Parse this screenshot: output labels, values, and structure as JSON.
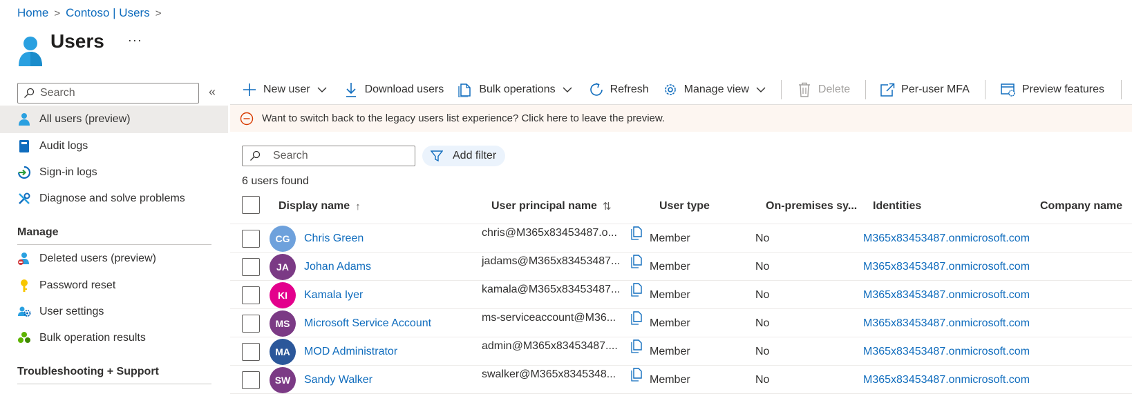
{
  "breadcrumb": [
    "Home",
    "Contoso | Users"
  ],
  "page": {
    "title": "Users",
    "more": "···"
  },
  "sidebar": {
    "search_placeholder": "Search",
    "collapse": "«",
    "items": [
      {
        "label": "All users (preview)",
        "icon": "user-icon"
      },
      {
        "label": "Audit logs",
        "icon": "book-icon"
      },
      {
        "label": "Sign-in logs",
        "icon": "sign-in-icon"
      },
      {
        "label": "Diagnose and solve problems",
        "icon": "wrench-icon"
      }
    ],
    "manage_header": "Manage",
    "manage_items": [
      {
        "label": "Deleted users (preview)",
        "icon": "deleted-user-icon"
      },
      {
        "label": "Password reset",
        "icon": "key-icon"
      },
      {
        "label": "User settings",
        "icon": "user-settings-icon"
      },
      {
        "label": "Bulk operation results",
        "icon": "bulk-results-icon"
      }
    ],
    "troubleshooting_header": "Troubleshooting + Support"
  },
  "toolbar": {
    "new_user": "New user",
    "download_users": "Download users",
    "bulk_operations": "Bulk operations",
    "refresh": "Refresh",
    "manage_view": "Manage view",
    "delete": "Delete",
    "per_user_mfa": "Per-user MFA",
    "preview_features": "Preview features"
  },
  "banner": {
    "text": "Want to switch back to the legacy users list experience? Click here to leave the preview."
  },
  "list": {
    "search_placeholder": "Search",
    "add_filter": "Add filter",
    "count": "6 users found"
  },
  "table": {
    "columns": {
      "display_name": "Display name",
      "display_name_sort": "↑",
      "upn": "User principal name",
      "upn_sort": "⇅",
      "user_type": "User type",
      "onprem": "On-premises sy...",
      "identities": "Identities",
      "company": "Company name"
    },
    "rows": [
      {
        "initials": "CG",
        "color": "#6ea1dc",
        "name": "Chris Green",
        "upn": "chris@M365x83453487.o...",
        "type": "Member",
        "onprem": "No",
        "identity": "M365x83453487.onmicrosoft.com"
      },
      {
        "initials": "JA",
        "color": "#7b3a85",
        "name": "Johan Adams",
        "upn": "jadams@M365x83453487...",
        "type": "Member",
        "onprem": "No",
        "identity": "M365x83453487.onmicrosoft.com"
      },
      {
        "initials": "KI",
        "color": "#e3008c",
        "name": "Kamala Iyer",
        "upn": "kamala@M365x83453487...",
        "type": "Member",
        "onprem": "No",
        "identity": "M365x83453487.onmicrosoft.com"
      },
      {
        "initials": "MS",
        "color": "#7b3a85",
        "name": "Microsoft Service Account",
        "upn": "ms-serviceaccount@M36...",
        "type": "Member",
        "onprem": "No",
        "identity": "M365x83453487.onmicrosoft.com"
      },
      {
        "initials": "MA",
        "color": "#2b579a",
        "name": "MOD Administrator",
        "upn": "admin@M365x83453487....",
        "type": "Member",
        "onprem": "No",
        "identity": "M365x83453487.onmicrosoft.com"
      },
      {
        "initials": "SW",
        "color": "#7b3a85",
        "name": "Sandy Walker",
        "upn": "swalker@M365x8345348...",
        "type": "Member",
        "onprem": "No",
        "identity": "M365x83453487.onmicrosoft.com"
      }
    ]
  },
  "colors": {
    "accent": "#0f6cbd",
    "banner_bg": "#fdf6f1",
    "warning": "#d83b01"
  }
}
